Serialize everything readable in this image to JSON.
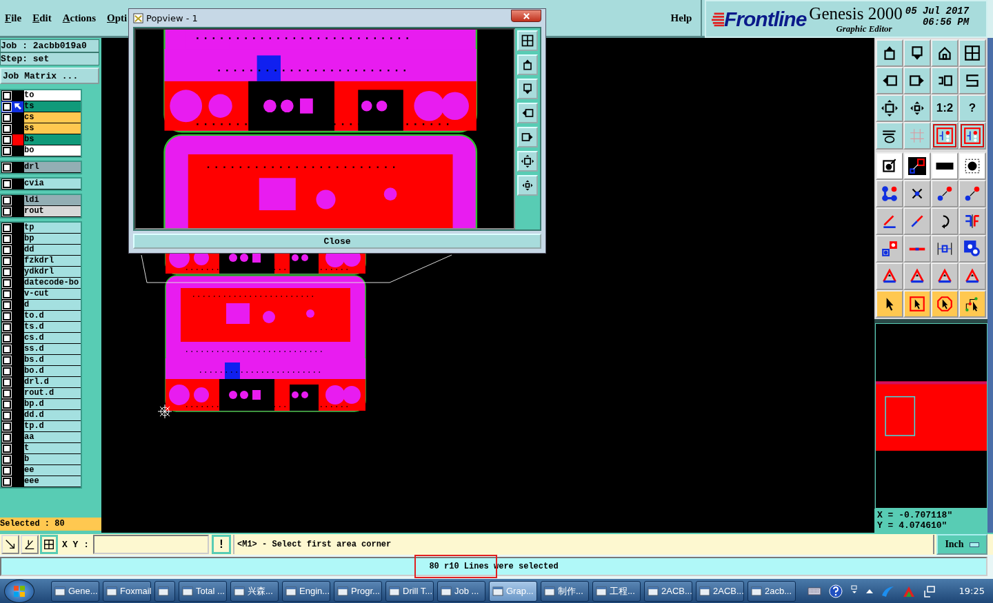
{
  "menu": [
    {
      "label": "File"
    },
    {
      "label": "Edit"
    },
    {
      "label": "Actions"
    },
    {
      "label": "Opti"
    }
  ],
  "help": "Help",
  "brand": {
    "logo": "Frontline",
    "product": "Genesis 2000",
    "subtitle": "Graphic Editor",
    "date": "05 Jul 2017",
    "time": "06:56 PM"
  },
  "job": {
    "job": "Job : 2acbb019a0",
    "step": "Step: set",
    "matrix_button": "Job Matrix ..."
  },
  "layer_groups": [
    {
      "layers": [
        {
          "name": "to",
          "color": "#ffffff",
          "checked": false,
          "selected": false,
          "displayed": false
        },
        {
          "name": "ts",
          "color": "#109a7a",
          "checked": false,
          "selected": true,
          "displayed": false
        },
        {
          "name": "cs",
          "color": "#ffc850",
          "checked": false,
          "selected": false,
          "displayed": false
        },
        {
          "name": "ss",
          "color": "#ffc850",
          "checked": false,
          "selected": false,
          "displayed": false
        },
        {
          "name": "bs",
          "color": "#109a7a",
          "checked": false,
          "selected": false,
          "displayed": true
        },
        {
          "name": "bo",
          "color": "#ffffff",
          "checked": false,
          "selected": false,
          "displayed": false
        }
      ]
    },
    {
      "layers": [
        {
          "name": "drl",
          "color": "#93aeb4",
          "checked": false,
          "selected": false,
          "displayed": false
        }
      ]
    },
    {
      "layers": [
        {
          "name": "cvia",
          "color": "#a4e0e0",
          "checked": false,
          "selected": false,
          "displayed": false
        }
      ]
    },
    {
      "layers": [
        {
          "name": "ldi",
          "color": "#93aeb4",
          "checked": false,
          "selected": false,
          "displayed": false
        },
        {
          "name": "rout",
          "color": "#d8d8d8",
          "checked": false,
          "selected": false,
          "displayed": false
        }
      ]
    },
    {
      "layers": [
        {
          "name": "tp",
          "color": "#a4e0e0",
          "checked": false,
          "selected": false,
          "displayed": false
        },
        {
          "name": "bp",
          "color": "#a4e0e0",
          "checked": false,
          "selected": false,
          "displayed": false
        },
        {
          "name": "dd",
          "color": "#a4e0e0",
          "checked": false,
          "selected": false,
          "displayed": false
        },
        {
          "name": "fzkdrl",
          "color": "#a4e0e0",
          "checked": false,
          "selected": false,
          "displayed": false
        },
        {
          "name": "ydkdrl",
          "color": "#a4e0e0",
          "checked": false,
          "selected": false,
          "displayed": false
        },
        {
          "name": "datecode-bo",
          "color": "#a4e0e0",
          "checked": false,
          "selected": false,
          "displayed": false
        },
        {
          "name": "v-cut",
          "color": "#a4e0e0",
          "checked": false,
          "selected": false,
          "displayed": false
        },
        {
          "name": "d",
          "color": "#a4e0e0",
          "checked": false,
          "selected": false,
          "displayed": false
        },
        {
          "name": "to.d",
          "color": "#a4e0e0",
          "checked": false,
          "selected": false,
          "displayed": false
        },
        {
          "name": "ts.d",
          "color": "#a4e0e0",
          "checked": false,
          "selected": false,
          "displayed": false
        },
        {
          "name": "cs.d",
          "color": "#a4e0e0",
          "checked": false,
          "selected": false,
          "displayed": false
        },
        {
          "name": "ss.d",
          "color": "#a4e0e0",
          "checked": false,
          "selected": false,
          "displayed": false
        },
        {
          "name": "bs.d",
          "color": "#a4e0e0",
          "checked": false,
          "selected": false,
          "displayed": false
        },
        {
          "name": "bo.d",
          "color": "#a4e0e0",
          "checked": false,
          "selected": false,
          "displayed": false
        },
        {
          "name": "drl.d",
          "color": "#a4e0e0",
          "checked": false,
          "selected": false,
          "displayed": false
        },
        {
          "name": "rout.d",
          "color": "#a4e0e0",
          "checked": false,
          "selected": false,
          "displayed": false
        },
        {
          "name": "bp.d",
          "color": "#a4e0e0",
          "checked": false,
          "selected": false,
          "displayed": false
        },
        {
          "name": "dd.d",
          "color": "#a4e0e0",
          "checked": false,
          "selected": false,
          "displayed": false
        },
        {
          "name": "tp.d",
          "color": "#a4e0e0",
          "checked": false,
          "selected": false,
          "displayed": false
        },
        {
          "name": "aa",
          "color": "#a4e0e0",
          "checked": false,
          "selected": false,
          "displayed": false
        },
        {
          "name": "t",
          "color": "#a4e0e0",
          "checked": false,
          "selected": false,
          "displayed": false
        },
        {
          "name": "b",
          "color": "#a4e0e0",
          "checked": false,
          "selected": false,
          "displayed": false
        },
        {
          "name": "ee",
          "color": "#a4e0e0",
          "checked": false,
          "selected": false,
          "displayed": false
        },
        {
          "name": "eee",
          "color": "#a4e0e0",
          "checked": false,
          "selected": false,
          "displayed": false
        }
      ]
    }
  ],
  "selected_count": "Selected : 80",
  "popview": {
    "title": "Popview - 1",
    "close_button": "Close"
  },
  "toolbar": [
    {
      "kind": "up"
    },
    {
      "kind": "down"
    },
    {
      "kind": "home"
    },
    {
      "kind": "window"
    },
    {
      "kind": "left"
    },
    {
      "kind": "right"
    },
    {
      "kind": "undo"
    },
    {
      "kind": "snake"
    },
    {
      "kind": "fit"
    },
    {
      "kind": "zoom"
    },
    {
      "kind": "text",
      "label": "1:2"
    },
    {
      "kind": "text",
      "label": "?"
    },
    {
      "kind": "tools"
    },
    {
      "kind": "grid"
    },
    {
      "kind": "net"
    },
    {
      "kind": "net"
    },
    {
      "kind": "probe"
    },
    {
      "kind": "clip"
    },
    {
      "kind": "ruler"
    },
    {
      "kind": "pad"
    },
    {
      "kind": "nodes"
    },
    {
      "kind": "cross"
    },
    {
      "kind": "link"
    },
    {
      "kind": "link"
    },
    {
      "kind": "angle"
    },
    {
      "kind": "diag"
    },
    {
      "kind": "rotate"
    },
    {
      "kind": "mirror"
    },
    {
      "kind": "pads"
    },
    {
      "kind": "bar"
    },
    {
      "kind": "measure"
    },
    {
      "kind": "blobs"
    },
    {
      "kind": "triangle"
    },
    {
      "kind": "triangle"
    },
    {
      "kind": "triangle"
    },
    {
      "kind": "triangle"
    },
    {
      "kind": "pointer"
    },
    {
      "kind": "pointer-box"
    },
    {
      "kind": "pointer-octagon"
    },
    {
      "kind": "route"
    }
  ],
  "coordinates": {
    "x": "X = -0.707118\"",
    "y": "Y = 4.074610\""
  },
  "command": {
    "xy_label": "X Y :",
    "exclaim": "!",
    "prompt": "<M1> - Select first area corner",
    "units": "Inch"
  },
  "status": "80 r10 Lines were selected",
  "taskbar": {
    "items": [
      {
        "kind": "app",
        "label": "Gene...",
        "selected": false
      },
      {
        "kind": "app",
        "label": "Foxmail",
        "selected": false
      },
      {
        "kind": "icon",
        "selected": false
      },
      {
        "kind": "app",
        "label": "Total ...",
        "selected": false
      },
      {
        "kind": "app",
        "label": "兴森...",
        "selected": false
      },
      {
        "kind": "app",
        "label": "Engin...",
        "selected": false
      },
      {
        "kind": "app",
        "label": "Progr...",
        "selected": false
      },
      {
        "kind": "app",
        "label": "Drill T...",
        "selected": false
      },
      {
        "kind": "app",
        "label": "Job ...",
        "selected": false
      },
      {
        "kind": "app",
        "label": "Grap...",
        "selected": true
      },
      {
        "kind": "app",
        "label": "制作...",
        "selected": false
      },
      {
        "kind": "app",
        "label": "工程...",
        "selected": false
      },
      {
        "kind": "app",
        "label": "2ACB...",
        "selected": false
      },
      {
        "kind": "app",
        "label": "2ACB...",
        "selected": false
      },
      {
        "kind": "app",
        "label": "2acb...",
        "selected": false
      }
    ],
    "clock": "19:25"
  }
}
